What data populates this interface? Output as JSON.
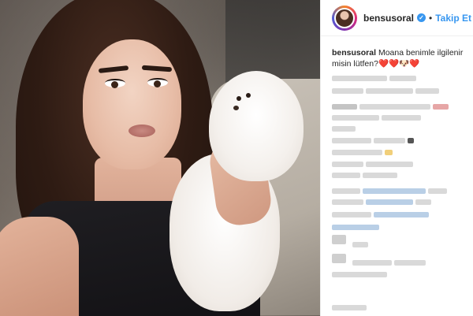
{
  "header": {
    "username": "bensusoral",
    "verified_icon": "verified-badge-icon",
    "separator": "•",
    "follow_label": "Takip Et"
  },
  "caption": {
    "username": "bensusoral",
    "text": "Moana benimle ilgilenir misin lütfen?❤️❤️🐶❤️"
  },
  "colors": {
    "accent_blue": "#3897f0",
    "text": "#262626",
    "border": "#efefef"
  }
}
